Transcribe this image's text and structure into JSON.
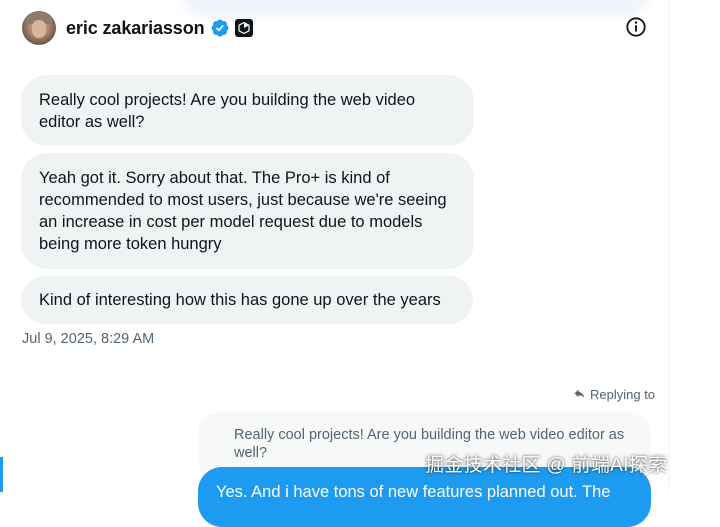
{
  "header": {
    "name": "eric zakariasson",
    "verified_icon": "verified-badge-icon",
    "affiliate_icon": "cursor-affiliate-icon",
    "info_icon": "info-icon"
  },
  "messages": [
    {
      "text": "Really cool projects! Are you building the web video editor as well?"
    },
    {
      "text": "Yeah got it. Sorry about that. The Pro+ is kind of recommended to most users, just because we're seeing an increase in cost per model request due to models being more token hungry"
    },
    {
      "text": "Kind of interesting how this has gone up over the years"
    }
  ],
  "timestamp": "Jul 9, 2025, 8:29 AM",
  "reply": {
    "replying_to_label": "Replying to",
    "quoted_text": "Really cool projects! Are you building the web video editor as well?",
    "own_text": "Yes. And i have tons of new features planned out. The"
  },
  "watermark": "掘金技术社区 @ 前端AI探索",
  "colors": {
    "accent": "#1d9bf0",
    "bubble_bg": "#eff3f4",
    "secondary_text": "#536471"
  }
}
